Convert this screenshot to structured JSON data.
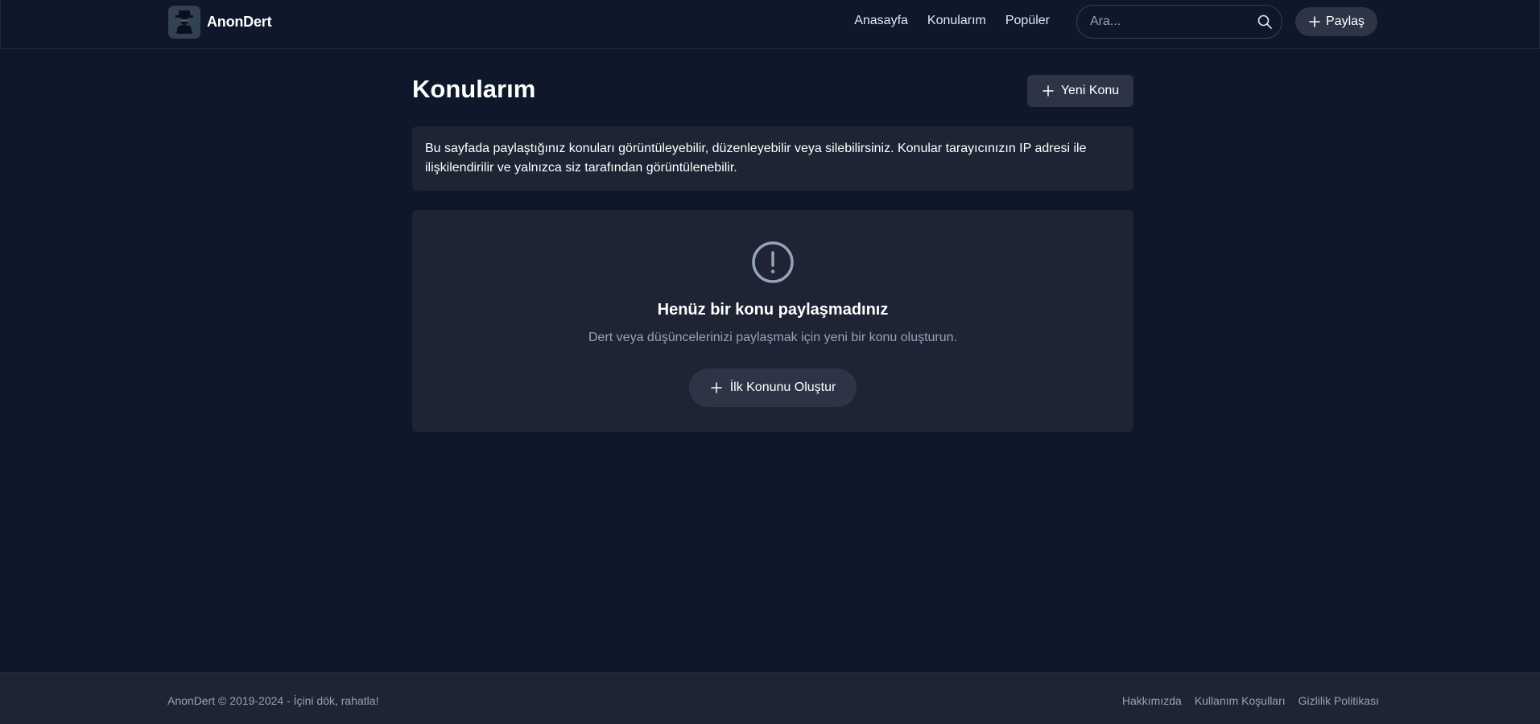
{
  "header": {
    "brand_name": "AnonDert",
    "nav": [
      {
        "label": "Anasayfa"
      },
      {
        "label": "Konularım"
      },
      {
        "label": "Popüler"
      }
    ],
    "search_placeholder": "Ara...",
    "share_label": "Paylaş"
  },
  "main": {
    "title": "Konularım",
    "new_topic_label": "Yeni Konu",
    "info_text": "Bu sayfada paylaştığınız konuları görüntüleyebilir, düzenleyebilir veya silebilirsiniz. Konular tarayıcınızın IP adresi ile ilişkilendirilir ve yalnızca siz tarafından görüntülenebilir.",
    "empty_state": {
      "icon": "exclamation-circle-icon",
      "title": "Henüz bir konu paylaşmadınız",
      "description": "Dert veya düşüncelerinizi paylaşmak için yeni bir konu oluşturun.",
      "button_label": "İlk Konunu Oluştur"
    }
  },
  "footer": {
    "copyright": "AnonDert © 2019-2024 - İçini dök, rahatla!",
    "links": [
      {
        "label": "Hakkımızda"
      },
      {
        "label": "Kullanım Koşulları"
      },
      {
        "label": "Gizlilik Politikası"
      }
    ]
  },
  "colors": {
    "background": "#0f172a",
    "surface": "#1e2433",
    "button": "#2d3446",
    "muted_text": "#94a3b8"
  }
}
